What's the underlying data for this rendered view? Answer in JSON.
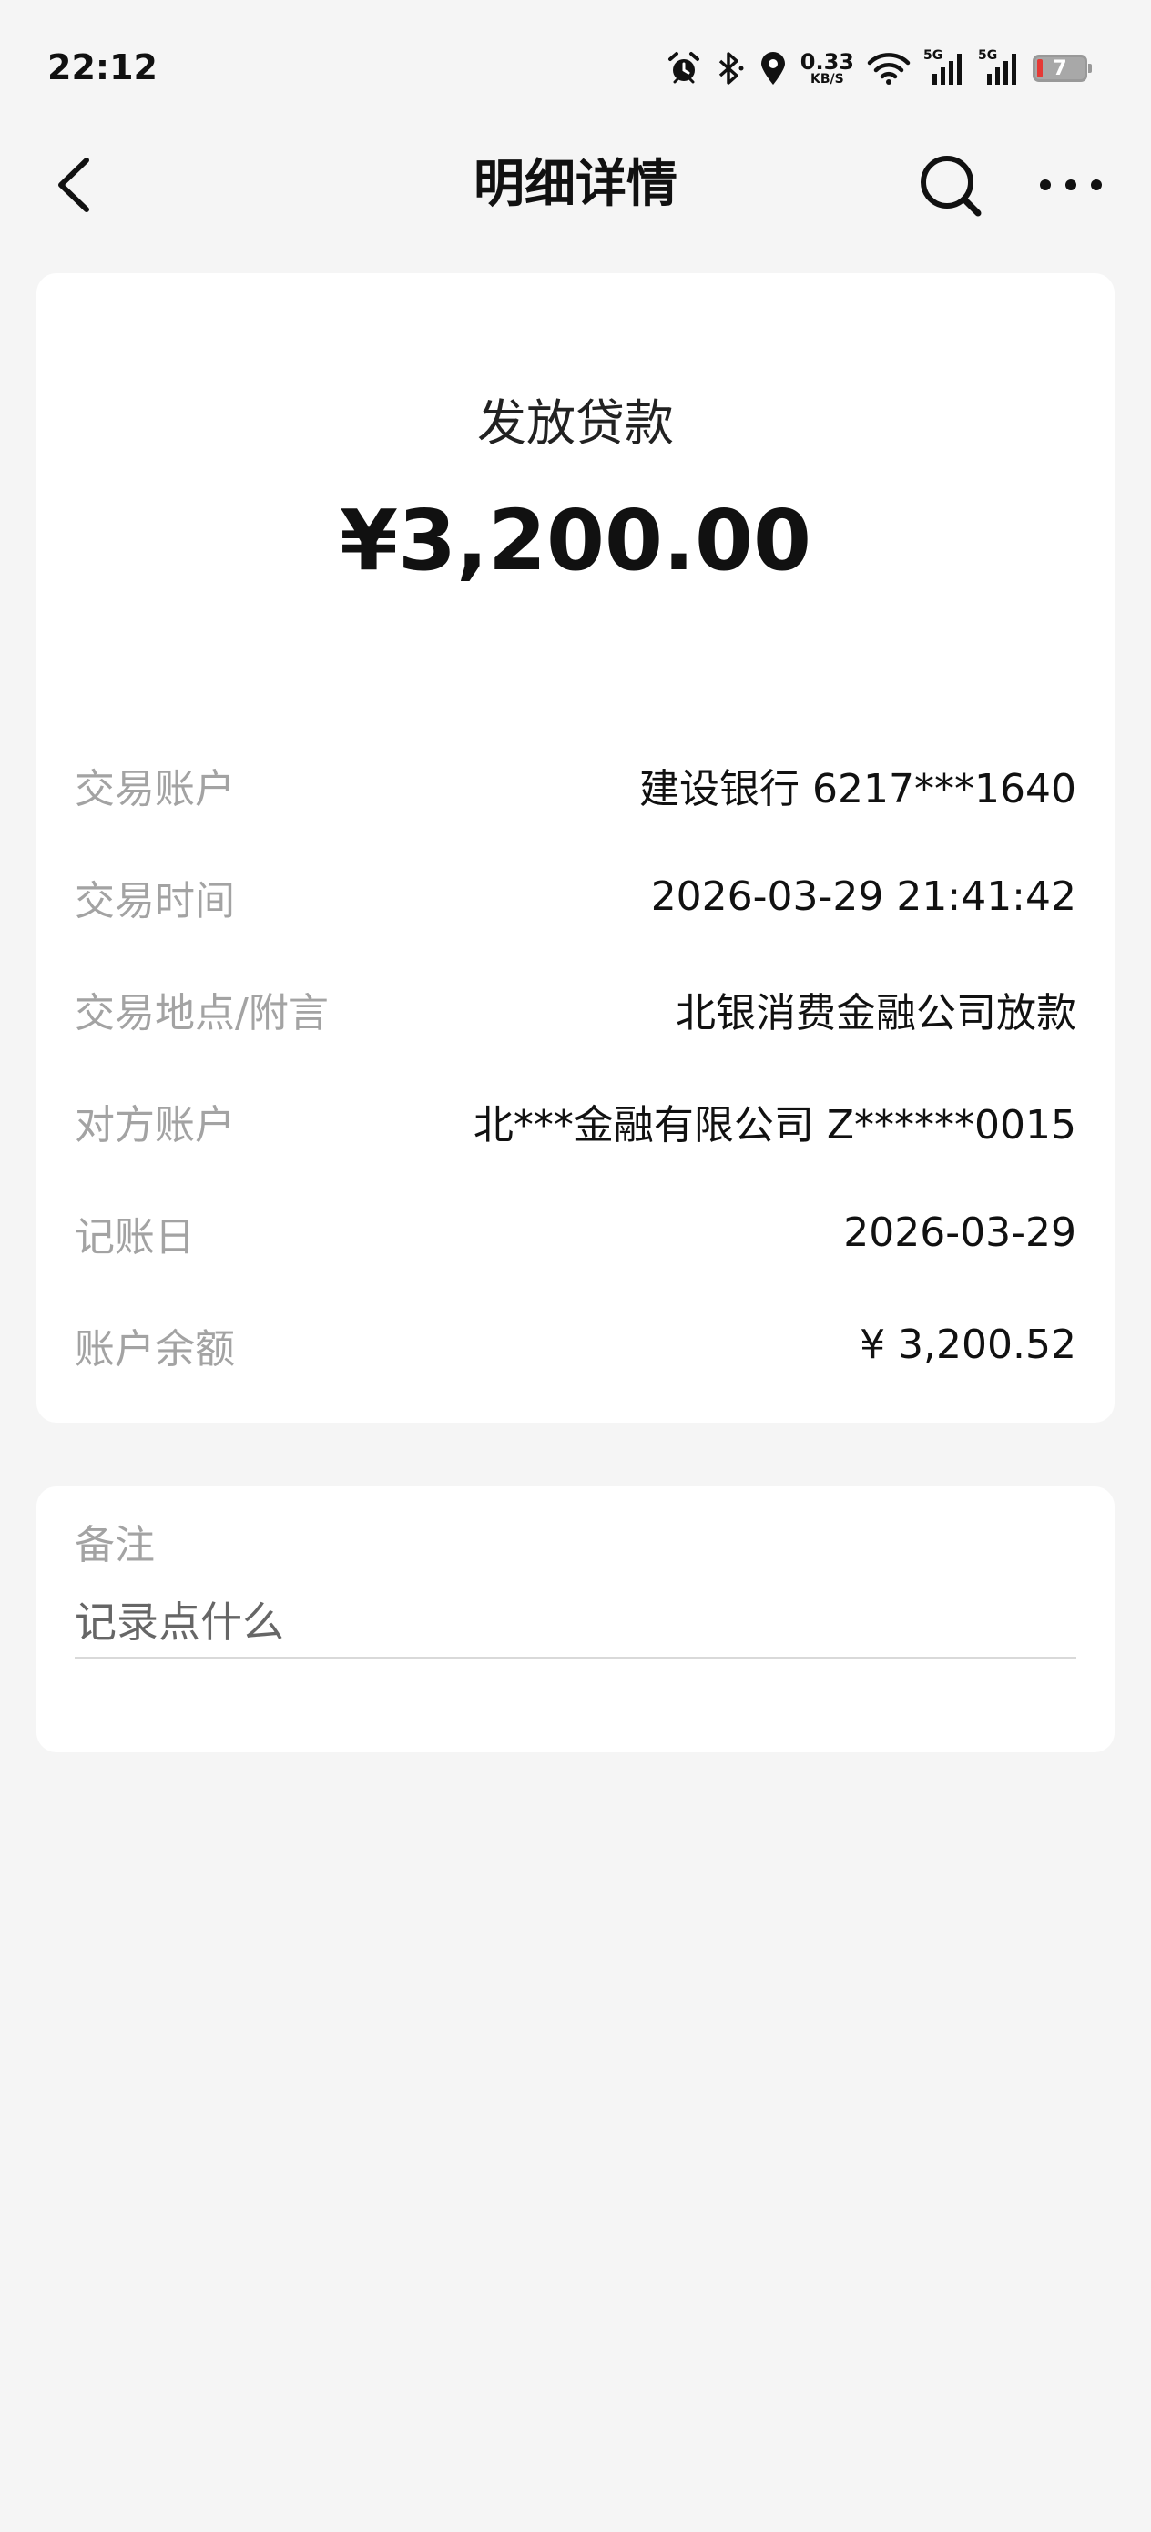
{
  "status_bar": {
    "time": "22:12",
    "net_speed_value": "0.33",
    "net_speed_unit": "KB/S",
    "signal1_label": "5G",
    "signal2_label": "5G",
    "battery_level": "7",
    "icons": [
      "alarm-icon",
      "bluetooth-icon",
      "location-icon",
      "wifi-icon",
      "signal-icon",
      "signal-icon",
      "battery-icon"
    ]
  },
  "nav": {
    "title": "明细详情",
    "icons": [
      "back-chevron-icon",
      "search-icon",
      "more-icon"
    ]
  },
  "transaction": {
    "type": "发放贷款",
    "amount": "¥3,200.00",
    "rows": [
      {
        "label": "交易账户",
        "value": "建设银行 6217***1640"
      },
      {
        "label": "交易时间",
        "value": "2026-03-29 21:41:42"
      },
      {
        "label": "交易地点/附言",
        "value": "北银消费金融公司放款"
      },
      {
        "label": "对方账户",
        "value": "北***金融有限公司 Z******0015"
      },
      {
        "label": "记账日",
        "value": "2026-03-29"
      },
      {
        "label": "账户余额",
        "value": "¥ 3,200.52"
      }
    ]
  },
  "note": {
    "label": "备注",
    "placeholder": "记录点什么"
  },
  "colors": {
    "background": "#f5f5f5",
    "card": "#ffffff",
    "label_gray": "#a3a3a3",
    "text": "#111111",
    "battery_low": "#e53935"
  }
}
